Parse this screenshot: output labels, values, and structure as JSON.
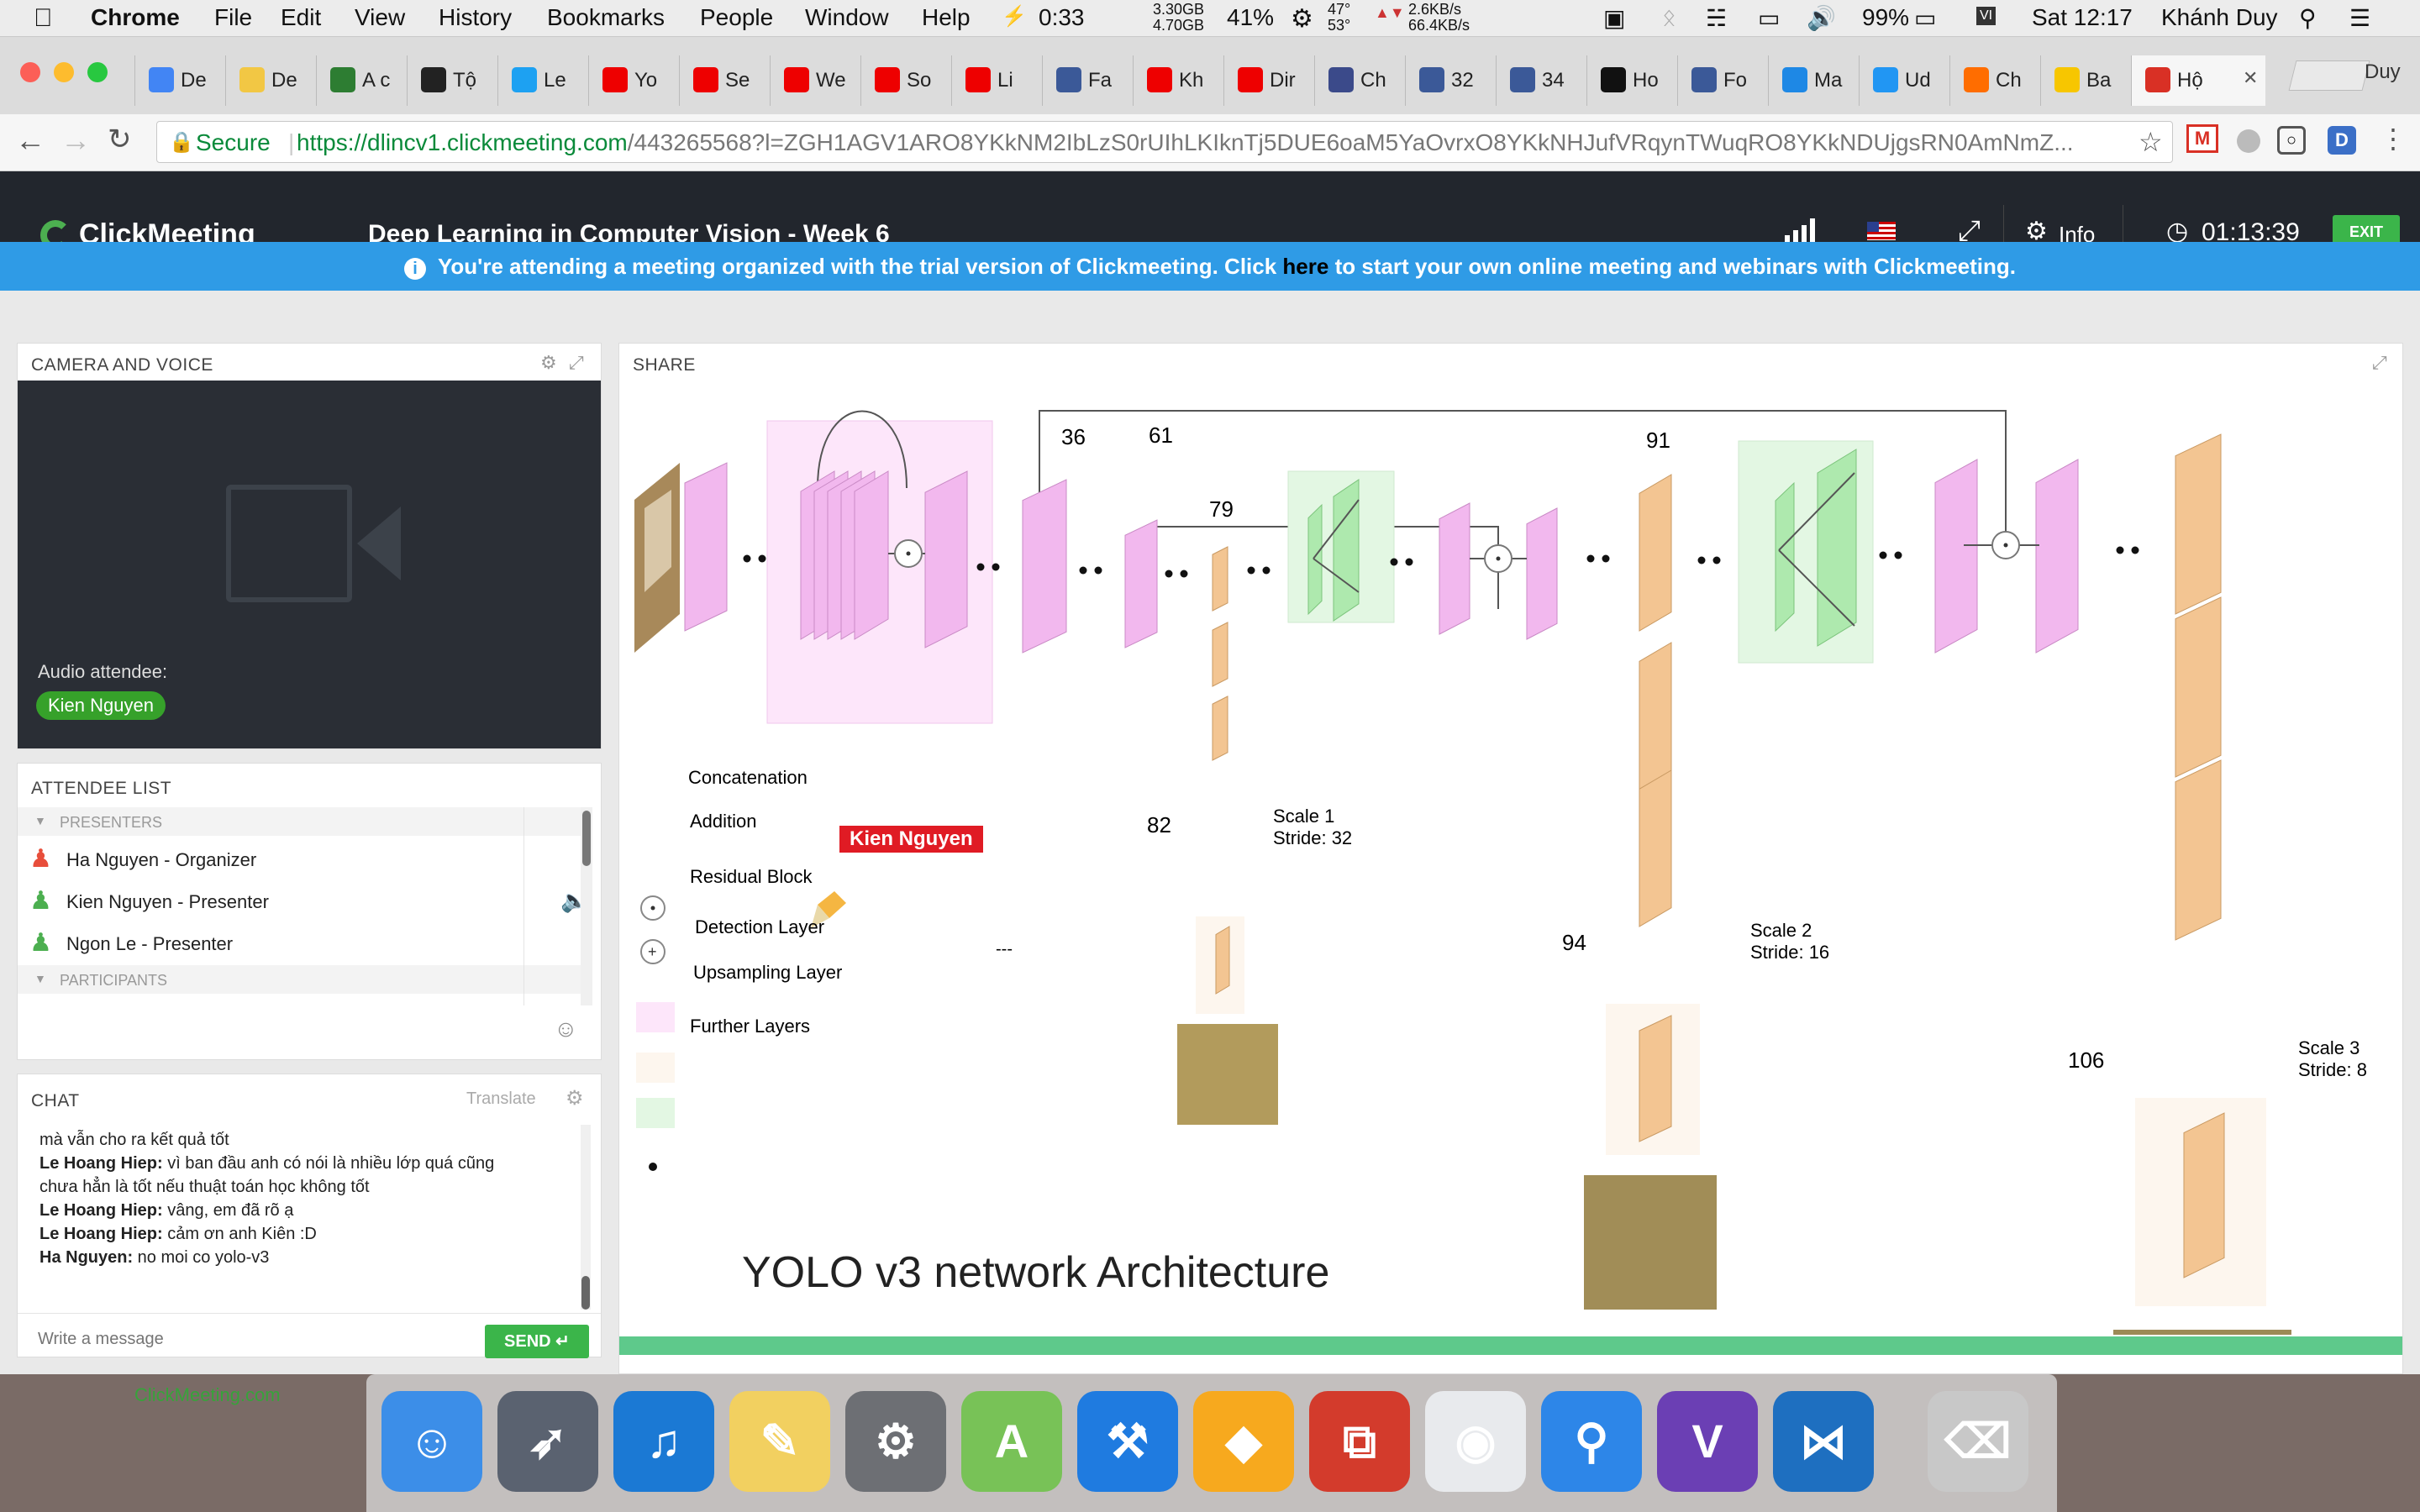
{
  "menubar": {
    "app": "Chrome",
    "items": [
      "File",
      "Edit",
      "View",
      "History",
      "Bookmarks",
      "People",
      "Window",
      "Help"
    ],
    "battery_time": "0:33",
    "mem_top": "3.30GB",
    "mem_bottom": "4.70GB",
    "cpu": "41%",
    "temp_top": "47°",
    "temp_bottom": "53°",
    "net_up": "2.6KB/s",
    "net_down": "66.4KB/s",
    "battery_pct": "99%",
    "clock": "Sat 12:17",
    "user": "Khánh Duy"
  },
  "tabs": [
    "De",
    "De",
    "A c",
    "Tộ",
    "Le",
    "Yo",
    "Se",
    "We",
    "So",
    "Li",
    "Fa",
    "Kh",
    "Dir",
    "Ch",
    "32",
    "34",
    "Ho",
    "Fo",
    "Ma",
    "Ud",
    "Ch",
    "Ba",
    "Hộ"
  ],
  "tab_colors": [
    "#4285f4",
    "#f2c744",
    "#2d7d32",
    "#222",
    "#1da1f2",
    "#e00",
    "#e00",
    "#e00",
    "#e00",
    "#e00",
    "#3b5998",
    "#e00",
    "#e00",
    "#3b4a8a",
    "#3b5998",
    "#3b5998",
    "#111",
    "#3b5998",
    "#1e88e5",
    "#2196f3",
    "#ff6d00",
    "#f7c600",
    "#d93025"
  ],
  "profile": "Duy",
  "address": {
    "secure": "Secure",
    "url_host": "https://dlincv1.clickmeeting.com",
    "url_rest": "/443265568?l=ZGH1AGV1ARO8YKkNM2IbLzS0rUIhLKIknTj5DUE6oaM5YaOvrxO8YKkNHJufVRqynTWuqRO8YKkNDUjgsRN0AmNmZ..."
  },
  "meeting": {
    "brand": "ClickMeeting",
    "title": "Deep Learning in Computer Vision - Week 6",
    "info": "Info",
    "timer": "01:13:39",
    "exit": "EXIT"
  },
  "banner": {
    "pre": "You're attending a meeting organized with the trial version of Clickmeeting. Click ",
    "link": "here",
    "post": " to start your own online meeting and webinars with Clickmeeting."
  },
  "camera": {
    "title": "CAMERA AND VOICE",
    "audio_label": "Audio attendee:",
    "audio_name": "Kien Nguyen"
  },
  "attendees": {
    "title": "ATTENDEE LIST",
    "presenters_label": "PRESENTERS",
    "presenters": [
      "Ha Nguyen - Organizer",
      "Kien Nguyen  - Presenter",
      "Ngon Le  - Presenter"
    ],
    "participants_label": "PARTICIPANTS"
  },
  "chat": {
    "title": "CHAT",
    "translate": "Translate",
    "messages": [
      {
        "name": "",
        "text": "mà vẫn cho ra kết quả tốt"
      },
      {
        "name": "Le Hoang Hiep:",
        "text": " vì ban đầu anh có nói là nhiều lớp quá cũng"
      },
      {
        "name": "",
        "text": "chưa hẳn là tốt nếu thuật toán học không tốt"
      },
      {
        "name": "Le Hoang Hiep:",
        "text": " vâng, em đã rõ ạ"
      },
      {
        "name": "Le Hoang Hiep:",
        "text": " cảm ơn anh Kiên :D"
      },
      {
        "name": "Ha Nguyen:",
        "text": " no moi co yolo-v3"
      }
    ],
    "placeholder": "Write a message",
    "send": "SEND",
    "footer": "ClickMeeting.com"
  },
  "share": {
    "title": "SHARE",
    "pointer_name": "Kien Nguyen",
    "slide_title": "YOLO v3 network Architecture",
    "layer_numbers": [
      "36",
      "61",
      "79",
      "91",
      "82",
      "94",
      "106"
    ],
    "legend": [
      "Concatenation",
      "Addition",
      "Residual Block",
      "Detection Layer",
      "Upsampling Layer",
      "Further Layers"
    ],
    "scales": [
      {
        "name": "Scale 1",
        "stride": "Stride: 32"
      },
      {
        "name": "Scale 2",
        "stride": "Stride: 16"
      },
      {
        "name": "Scale 3",
        "stride": "Stride: 8"
      }
    ],
    "dash": "---"
  },
  "dock": [
    "Finder",
    "Launchpad",
    "iTunes",
    "Notes",
    "System Preferences",
    "Android Studio",
    "Xcode",
    "Sketch",
    "Parallels",
    "Chrome",
    "Sourcetree",
    "Visual Studio",
    "VS Code",
    "Trash"
  ]
}
